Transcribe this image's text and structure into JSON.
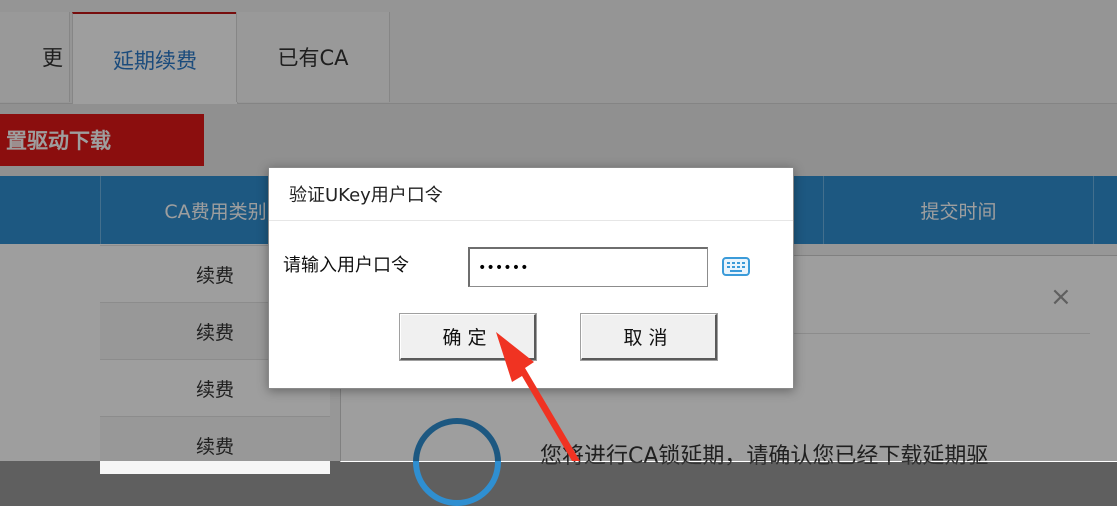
{
  "tabs": [
    {
      "label": "更"
    },
    {
      "label": "延期续费"
    },
    {
      "label": "已有CA"
    }
  ],
  "toolbar": {
    "driver_download": "置驱动下载"
  },
  "table": {
    "headers": [
      "CA费用类别",
      "提交时间"
    ],
    "rows": [
      "续费",
      "续费",
      "续费",
      "续费"
    ]
  },
  "background_dialog": {
    "close_symbol": "×",
    "message": "您将进行CA锁延期，请确认您已经下载延期驱"
  },
  "modal": {
    "title": "验证UKey用户口令",
    "password_label": "请输入用户口令",
    "password_value": "••••••",
    "confirm_label": "确定",
    "cancel_label": "取消"
  },
  "colors": {
    "accent_blue": "#2f8fd1",
    "active_tab_text": "#2b79c8",
    "alert_red": "#e01818",
    "arrow_red": "#f03322"
  },
  "icons": [
    "keyboard-icon",
    "arrow-pointer-icon"
  ]
}
